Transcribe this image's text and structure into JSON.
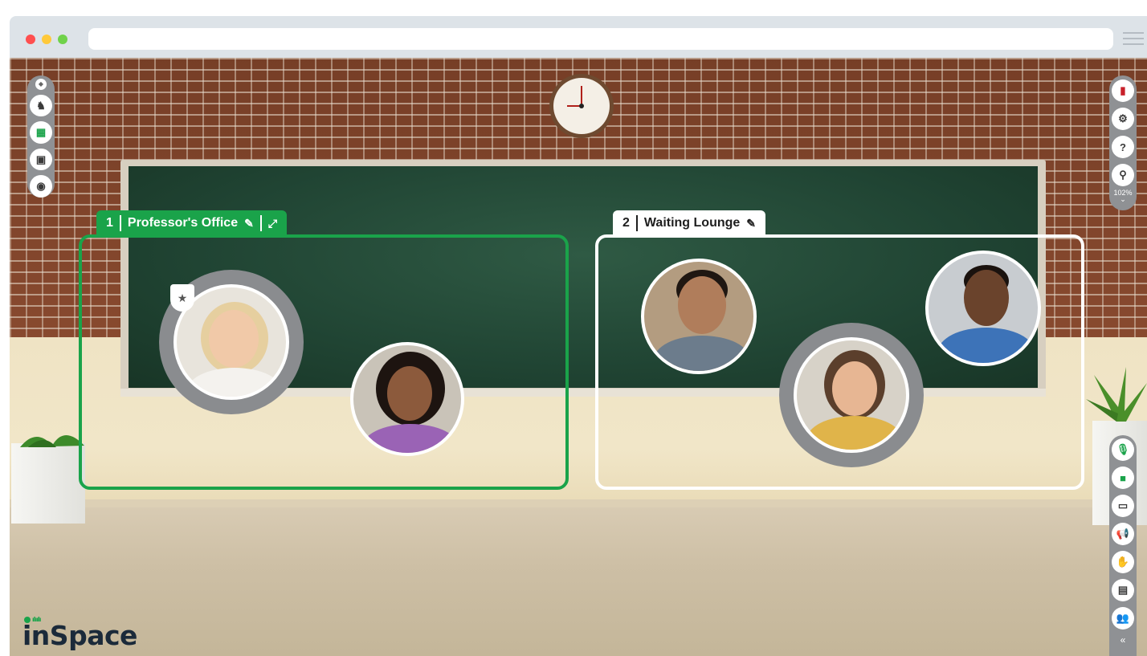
{
  "browser": {
    "url_value": ""
  },
  "rooms": [
    {
      "number": "1",
      "name": "Professor's Office",
      "edit_icon": "pencil-icon",
      "expand_icon": "expand-icon"
    },
    {
      "number": "2",
      "name": "Waiting Lounge",
      "edit_icon": "pencil-icon"
    }
  ],
  "left_toolbar": {
    "items": [
      "shield-icon",
      "speaker-presenter-icon",
      "grid-layout-icon",
      "image-icon",
      "record-icon"
    ]
  },
  "right_toolbar": {
    "items": [
      "exit-icon",
      "settings-icon",
      "help-icon",
      "location-icon"
    ],
    "zoom": "102%"
  },
  "bottom_right_toolbar": {
    "items": [
      "microphone-icon",
      "camera-icon",
      "screen-share-icon",
      "broadcast-icon",
      "raise-hand-icon",
      "chat-icon",
      "people-icon",
      "collapse-icon"
    ]
  },
  "logo": {
    "text": "inSpace"
  },
  "colors": {
    "room_green": "#1aa34a",
    "toolbar_gray": "#8f9194",
    "exit_red": "#c8202a"
  }
}
